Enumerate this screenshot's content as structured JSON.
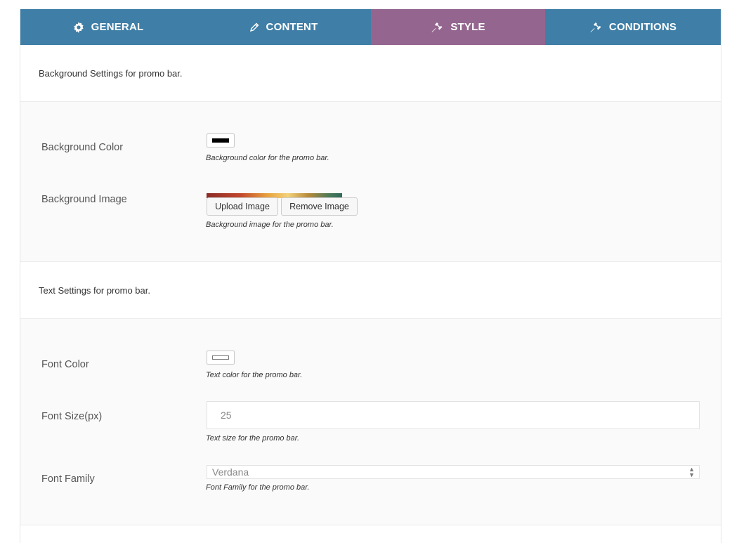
{
  "tabs": [
    {
      "label": "GENERAL",
      "icon": "gear-icon"
    },
    {
      "label": "CONTENT",
      "icon": "pencil-icon"
    },
    {
      "label": "STYLE",
      "icon": "pin-icon",
      "active": true
    },
    {
      "label": "CONDITIONS",
      "icon": "pin-icon"
    }
  ],
  "colors": {
    "tab_bg": "#3f7ea6",
    "tab_active_bg": "#94668f",
    "background_color_value": "#000000",
    "font_color_value": "#ffffff"
  },
  "background_section": {
    "heading": "Background Settings for promo bar.",
    "color_label": "Background Color",
    "color_desc": "Background color for the promo bar.",
    "image_label": "Background Image",
    "upload_label": "Upload Image",
    "remove_label": "Remove Image",
    "image_desc": "Background image for the promo bar."
  },
  "text_section": {
    "heading": "Text Settings for promo bar.",
    "font_color_label": "Font Color",
    "font_color_desc": "Text color for the promo bar.",
    "font_size_label": "Font Size(px)",
    "font_size_value": "25",
    "font_size_desc": "Text size for the promo bar.",
    "font_family_label": "Font Family",
    "font_family_value": "Verdana",
    "font_family_desc": "Font Family for the promo bar."
  }
}
